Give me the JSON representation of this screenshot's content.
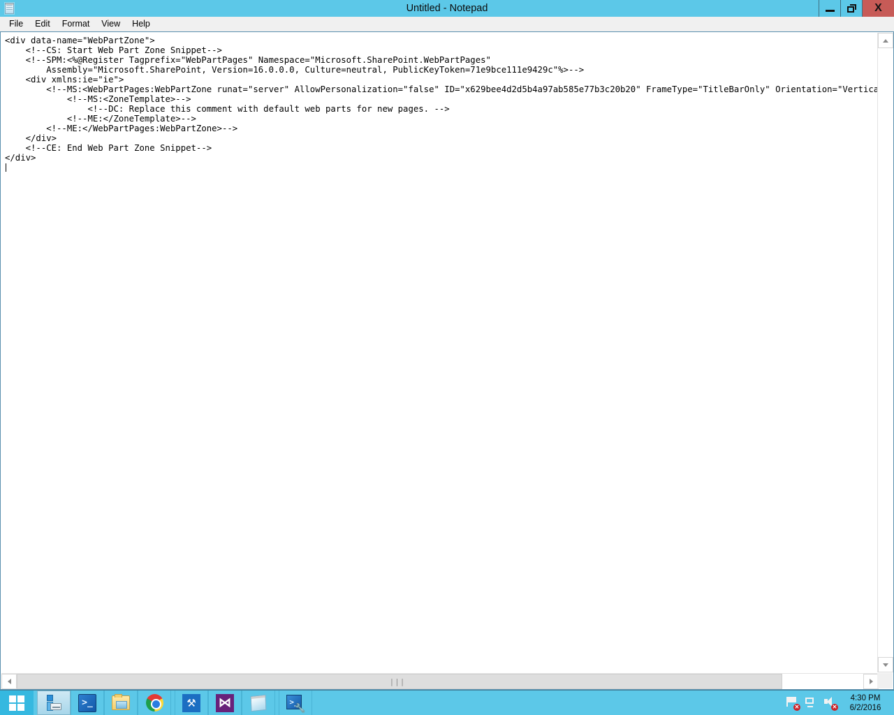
{
  "window": {
    "title": "Untitled - Notepad",
    "icon": "notepad-icon",
    "controls": {
      "minimize": "–",
      "restore": "❐",
      "close": "X"
    }
  },
  "menubar": {
    "items": [
      {
        "label": "File"
      },
      {
        "label": "Edit"
      },
      {
        "label": "Format"
      },
      {
        "label": "View"
      },
      {
        "label": "Help"
      }
    ]
  },
  "editor": {
    "lines": [
      "<div data-name=\"WebPartZone\">",
      "    <!--CS: Start Web Part Zone Snippet-->",
      "    <!--SPM:<%@Register Tagprefix=\"WebPartPages\" Namespace=\"Microsoft.SharePoint.WebPartPages\"",
      "        Assembly=\"Microsoft.SharePoint, Version=16.0.0.0, Culture=neutral, PublicKeyToken=71e9bce111e9429c\"%>-->",
      "    <div xmlns:ie=\"ie\">",
      "        <!--MS:<WebPartPages:WebPartZone runat=\"server\" AllowPersonalization=\"false\" ID=\"x629bee4d2d5b4a97ab585e77b3c20b20\" FrameType=\"TitleBarOnly\" Orientation=\"Vertical\">-->",
      "            <!--MS:<ZoneTemplate>-->",
      "                <!--DC: Replace this comment with default web parts for new pages. -->",
      "            <!--ME:</ZoneTemplate>-->",
      "        <!--ME:</WebPartPages:WebPartZone>-->",
      "    </div>",
      "    <!--CE: End Web Part Zone Snippet-->",
      "</div>",
      ""
    ],
    "caret_line": 13
  },
  "scrollbars": {
    "vertical": {
      "up_arrow": "▲",
      "down_arrow": "▼"
    },
    "horizontal": {
      "left_arrow": "◀",
      "right_arrow": "▶",
      "grip": "|||"
    }
  },
  "taskbar": {
    "start": "start-button",
    "buttons": [
      {
        "name": "server-manager",
        "label": "Server Manager",
        "active": true
      },
      {
        "name": "windows-powershell",
        "label": "Windows PowerShell",
        "active": false
      },
      {
        "name": "file-explorer",
        "label": "File Explorer",
        "active": false
      },
      {
        "name": "google-chrome",
        "label": "Google Chrome",
        "active": false
      },
      {
        "name": "visual-studio-tools",
        "label": "Visual Studio Tools",
        "active": false
      },
      {
        "name": "visual-studio",
        "label": "Visual Studio",
        "active": false
      },
      {
        "name": "notepad",
        "label": "Notepad",
        "active": false
      },
      {
        "name": "powershell-ise",
        "label": "Windows PowerShell ISE",
        "active": false
      }
    ],
    "tray": {
      "icons": [
        {
          "name": "action-center-flag-icon",
          "badge": "x"
        },
        {
          "name": "network-icon",
          "badge": ""
        },
        {
          "name": "volume-icon",
          "badge": "x"
        }
      ],
      "time": "4:30 PM",
      "date": "6/2/2016"
    }
  },
  "colors": {
    "accent": "#5cc8e8",
    "close_button": "#c75b57",
    "window_chrome": "#f0f0f0",
    "editor_background": "#ffffff",
    "editor_text": "#000000",
    "editor_border": "#5a8fae"
  }
}
